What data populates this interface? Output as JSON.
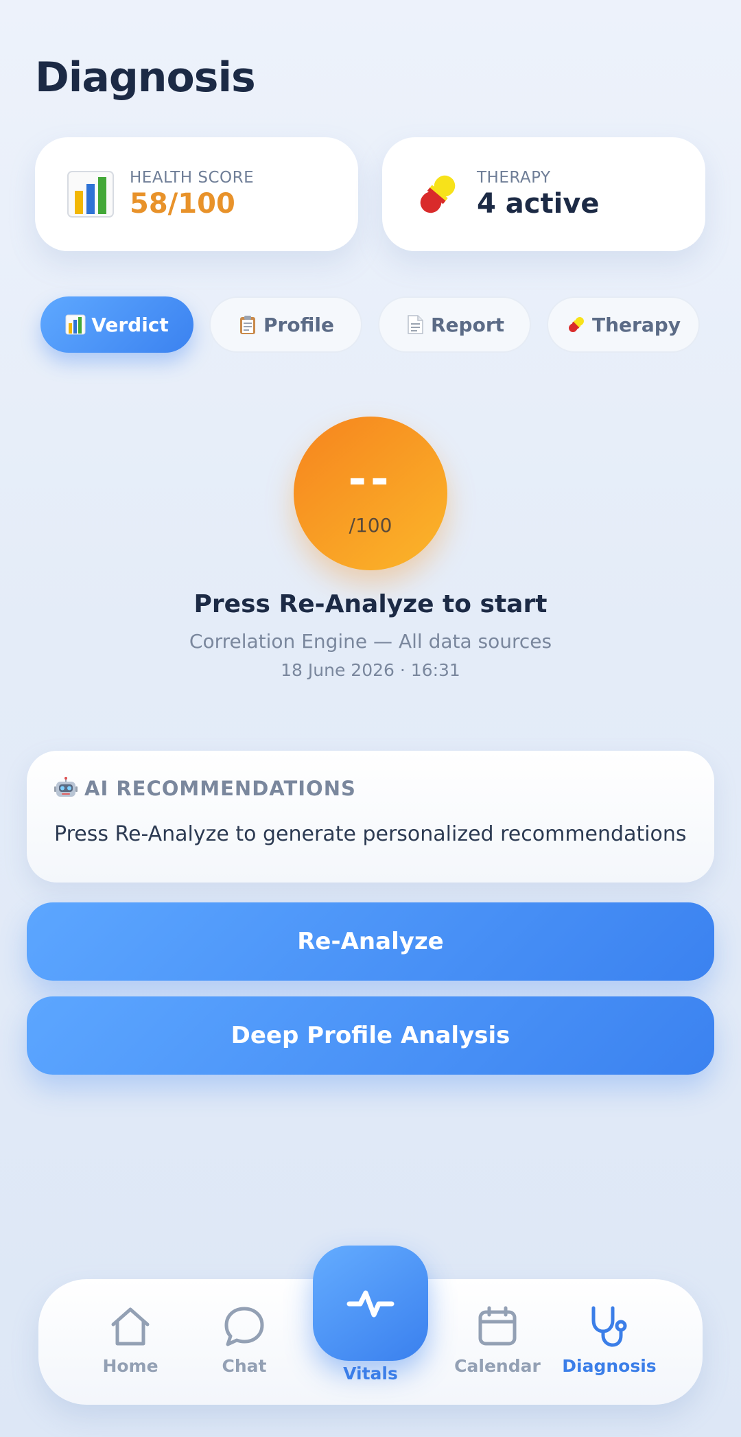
{
  "header": {
    "title": "Diagnosis"
  },
  "stats": {
    "health": {
      "label": "HEALTH SCORE",
      "value": "58/100",
      "icon": "bar-chart-icon"
    },
    "therapy": {
      "label": "THERAPY",
      "value": "4 active",
      "icon": "pill-icon"
    }
  },
  "tabs": [
    {
      "label": "Verdict",
      "icon": "bar-chart-icon",
      "active": true
    },
    {
      "label": "Profile",
      "icon": "clipboard-icon",
      "active": false
    },
    {
      "label": "Report",
      "icon": "document-icon",
      "active": false
    },
    {
      "label": "Therapy",
      "icon": "pill-icon",
      "active": false
    }
  ],
  "verdict": {
    "score": "--",
    "score_max": "/100",
    "title": "Press Re-Analyze to start",
    "subtitle": "Correlation Engine — All data sources",
    "date": "18 June 2026 · 16:31"
  },
  "ai": {
    "icon": "robot-icon",
    "heading": "AI RECOMMENDATIONS",
    "body": "Press Re-Analyze to generate personalized recommendations"
  },
  "actions": {
    "reanalyze": "Re-Analyze",
    "deep_profile": "Deep Profile Analysis"
  },
  "nav": {
    "items": [
      {
        "label": "Home",
        "icon": "home-icon",
        "active": false
      },
      {
        "label": "Chat",
        "icon": "chat-bubble-icon",
        "active": false
      },
      {
        "label": "Vitals",
        "icon": "pulse-icon",
        "active": false
      },
      {
        "label": "Calendar",
        "icon": "calendar-icon",
        "active": false
      },
      {
        "label": "Diagnosis",
        "icon": "stethoscope-icon",
        "active": true
      }
    ]
  },
  "colors": {
    "accent": "#3b82f0",
    "score_orange": "#e8922a",
    "score_gradient_start": "#f6841e",
    "score_gradient_end": "#fbb62a"
  }
}
